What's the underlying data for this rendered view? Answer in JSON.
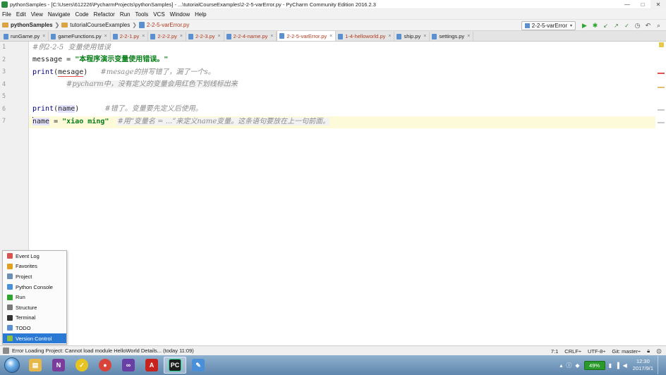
{
  "window": {
    "title": "pythonSamples - [C:\\Users\\612226\\PycharmProjects\\pythonSamples] - ...\\tutorialCourseExamples\\2-2-5-varError.py - PyCharm Community Edition 2016.2.3",
    "minimize": "—",
    "maximize": "□",
    "close": "✕"
  },
  "menu": [
    "File",
    "Edit",
    "View",
    "Navigate",
    "Code",
    "Refactor",
    "Run",
    "Tools",
    "VCS",
    "Window",
    "Help"
  ],
  "breadcrumb": [
    "pythonSamples",
    "tutorialCourseExamples",
    "2-2-5-varError.py"
  ],
  "run_config": "2-2-5-varError",
  "toolbar_glyphs": {
    "dropdown": "▾",
    "run": "▶",
    "debug": "✱",
    "vcs_update": "↙",
    "vcs_commit": "↗",
    "compare": "✓",
    "history": "◷",
    "revert": "↶",
    "search": "⌕"
  },
  "tabs": [
    {
      "name": "runGame.py",
      "error": false,
      "active": false
    },
    {
      "name": "gameFunctions.py",
      "error": false,
      "active": false
    },
    {
      "name": "2-2-1.py",
      "error": true,
      "active": false
    },
    {
      "name": "2-2-2.py",
      "error": true,
      "active": false
    },
    {
      "name": "2-2-3.py",
      "error": true,
      "active": false
    },
    {
      "name": "2-2-4-name.py",
      "error": true,
      "active": false
    },
    {
      "name": "2-2-5-varError.py",
      "error": true,
      "active": true
    },
    {
      "name": "1-4-helloworld.py",
      "error": true,
      "active": false
    },
    {
      "name": "ship.py",
      "error": false,
      "active": false
    },
    {
      "name": "settings.py",
      "error": false,
      "active": false
    }
  ],
  "tab_close_glyph": "×",
  "code": {
    "line_numbers": [
      "1",
      "2",
      "3",
      "4",
      "5",
      "6",
      "7"
    ],
    "l1_comment": "#例2-2-5  变量使用错误",
    "l2_name": "message",
    "l2_op": " = ",
    "l2_str": "\"本程序演示变量使用错误。\"",
    "l3_func": "print",
    "l3_open": "(",
    "l3_arg": "mesage",
    "l3_close": ")",
    "l3_comment": "#mesage的拼写错了，漏了一个s。",
    "l4_comment": "#pycharm中，没有定义的变量会用红色下划线标出来",
    "l6_func": "print",
    "l6_open": "(",
    "l6_arg": "name",
    "l6_close": ")",
    "l6_comment": "#错了。变量要先定义后使用。",
    "l7_name": "name",
    "l7_op": " = ",
    "l7_str": "\"xiao ming\"",
    "l7_comment": "#用“变量名 = ...”来定义name变量。这条语句要放在上一句前面。"
  },
  "tool_windows": [
    {
      "label": "Event Log",
      "color": "#d9534f",
      "selected": false
    },
    {
      "label": "Favorites",
      "color": "#e0a020",
      "selected": false
    },
    {
      "label": "Project",
      "color": "#6a8fb5",
      "selected": false
    },
    {
      "label": "Python Console",
      "color": "#4a90d9",
      "selected": false
    },
    {
      "label": "Run",
      "color": "#2fa52f",
      "selected": false
    },
    {
      "label": "Structure",
      "color": "#7a7a7a",
      "selected": false
    },
    {
      "label": "Terminal",
      "color": "#333333",
      "selected": false
    },
    {
      "label": "TODO",
      "color": "#5a8fd0",
      "selected": false
    },
    {
      "label": "Version Control",
      "color": "#8fbf3f",
      "selected": true
    }
  ],
  "status": {
    "message": "Error Loading Project: Cannot load module HelloWorld Details... (today 11:09)",
    "position": "7:1",
    "line_sep": "CRLF÷",
    "encoding": "UTF-8÷",
    "vcs": "Git: master÷"
  },
  "taskbar": {
    "apps": [
      {
        "name": "file-explorer",
        "glyph": "▤",
        "color": "#e6b84a"
      },
      {
        "name": "onenote",
        "glyph": "N",
        "color": "#7b3d9c"
      },
      {
        "name": "norton",
        "glyph": "✓",
        "color": "#e8c420"
      },
      {
        "name": "chrome",
        "glyph": "●",
        "color": "#d9443a"
      },
      {
        "name": "visual-studio",
        "glyph": "∞",
        "color": "#6a3fa5"
      },
      {
        "name": "acrobat",
        "glyph": "A",
        "color": "#c8221d"
      },
      {
        "name": "pycharm",
        "glyph": "PC",
        "color": "#1d1d1d"
      },
      {
        "name": "notepad",
        "glyph": "✎",
        "color": "#4a90d9"
      }
    ],
    "battery": "49%",
    "time": "12:30",
    "date": "2017/9/1"
  },
  "colors": {
    "accent": "#2a7ad5",
    "error": "#b03a1e",
    "string": "#067d17",
    "comment": "#8c8c8c",
    "caret_line": "#fcfad9"
  }
}
